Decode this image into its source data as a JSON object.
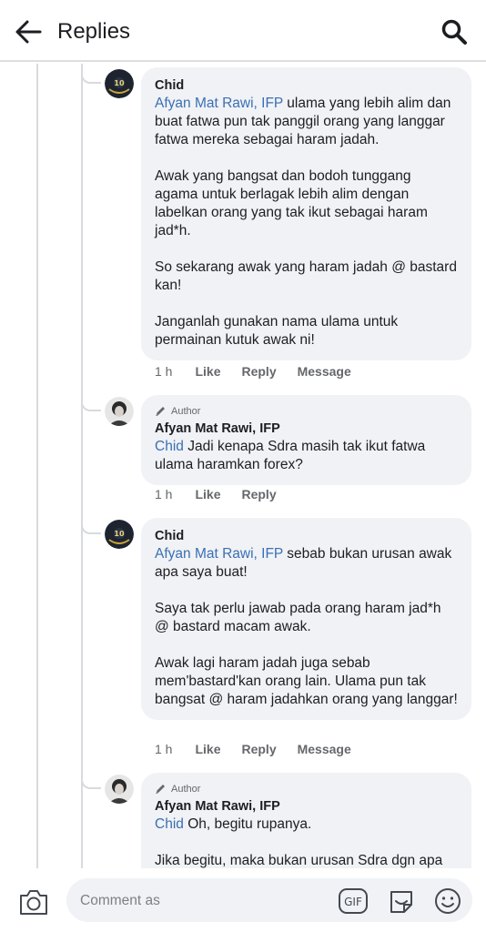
{
  "header": {
    "title": "Replies",
    "back_icon": "arrow-left-icon",
    "search_icon": "search-icon"
  },
  "comments": [
    {
      "author": "Chid",
      "is_author": false,
      "mention": "Afyan Mat Rawi, IFP",
      "text": " ulama yang lebih alim dan buat fatwa pun tak panggil orang yang langgar fatwa mereka sebagai haram jadah.\n\nAwak yang bangsat dan bodoh tunggang agama untuk berlagak lebih alim dengan labelkan orang yang tak ikut sebagai haram jad*h.\n\nSo sekarang awak yang haram jadah @ bastard kan!\n\nJanganlah gunakan nama ulama untuk permainan kutuk awak ni!",
      "time": "1 h",
      "like": "Like",
      "reply": "Reply",
      "message": "Message"
    },
    {
      "author": "Afyan Mat Rawi, IFP",
      "is_author": true,
      "badge": "Author",
      "mention": "Chid",
      "text": " Jadi kenapa Sdra masih tak ikut fatwa ulama haramkan forex?",
      "time": "1 h",
      "like": "Like",
      "reply": "Reply"
    },
    {
      "author": "Chid",
      "is_author": false,
      "mention": "Afyan Mat Rawi, IFP",
      "text": " sebab bukan urusan awak apa saya buat!\n\nSaya tak perlu jawab pada orang haram jad*h @ bastard macam awak.\n\nAwak lagi haram jadah juga sebab mem'bastard'kan orang lain. Ulama pun tak bangsat @ haram jadahkan orang yang langgar!",
      "time": "1 h",
      "like": "Like",
      "reply": "Reply",
      "message": "Message"
    },
    {
      "author": "Afyan Mat Rawi, IFP",
      "is_author": true,
      "badge": "Author",
      "mention": "Chid",
      "text": " Oh, begitu rupanya.\n\nJika begitu, maka bukan urusan Sdra dgn apa"
    }
  ],
  "composer": {
    "placeholder": "Comment as",
    "gif_label": "GIF",
    "camera_icon": "camera-icon",
    "sticker_icon": "sticker-icon",
    "emoji_icon": "emoji-icon"
  },
  "colors": {
    "mention": "#3a6fb4",
    "bubble": "#f0f2f5",
    "secondary_text": "#65676b"
  }
}
